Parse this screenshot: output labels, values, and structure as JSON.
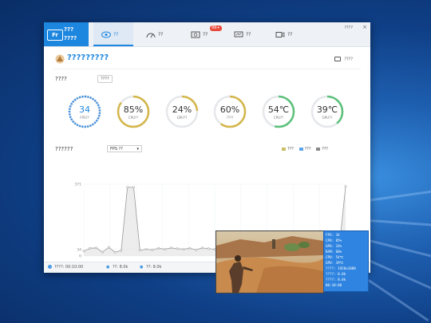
{
  "app": {
    "logo_mark": "Fr",
    "logo_line1": "???",
    "logo_line2": "????",
    "tabs": [
      {
        "label": "??",
        "icon": "eye-icon",
        "active": true
      },
      {
        "label": "??",
        "icon": "speedometer-icon",
        "active": false
      },
      {
        "label": "??",
        "icon": "screenshot-icon",
        "active": false,
        "badge": "99+"
      },
      {
        "label": "??",
        "icon": "network-icon",
        "active": false
      },
      {
        "label": "??",
        "icon": "video-icon",
        "active": false
      }
    ],
    "titlebar_right": "????"
  },
  "game": {
    "name": "?????????",
    "screenshot_label": "????"
  },
  "hardware": {
    "title": "????",
    "button": "????",
    "gauges": [
      {
        "value": "34",
        "label": "FPS??",
        "percent": 100,
        "color": "#3b8fe0",
        "dashed": true
      },
      {
        "value": "85%",
        "label": "CPU??",
        "percent": 85,
        "color": "#d4b64a"
      },
      {
        "value": "24%",
        "label": "GPU??",
        "percent": 24,
        "color": "#d4b64a"
      },
      {
        "value": "60%",
        "label": "????",
        "percent": 60,
        "color": "#d4b64a"
      },
      {
        "value": "54℃",
        "label": "CPU??",
        "percent": 54,
        "color": "#5cc07a"
      },
      {
        "value": "39℃",
        "label": "GPU??",
        "percent": 39,
        "color": "#5cc07a"
      }
    ]
  },
  "perf": {
    "title": "??????",
    "select": "FPS ??",
    "legend": [
      {
        "name": "???",
        "color": "#cbbf66"
      },
      {
        "name": "???",
        "color": "#5aa4e6"
      },
      {
        "name": "???",
        "color": "#888888"
      }
    ]
  },
  "chart_data": {
    "type": "line",
    "y_ticks": [
      "371",
      "34",
      "0"
    ],
    "ylim": [
      0,
      371
    ],
    "series": [
      {
        "values": [
          25,
          40,
          42,
          20,
          45,
          20,
          28,
          355,
          355,
          30,
          35,
          32,
          40,
          35,
          42,
          38,
          35,
          40,
          32,
          42,
          38,
          35,
          36,
          30,
          35,
          40,
          32,
          36,
          34,
          40,
          35,
          42,
          38,
          30,
          33,
          32,
          35,
          36,
          40,
          38,
          30,
          50,
          360
        ]
      }
    ]
  },
  "status": {
    "item1": "????: 00:10:00",
    "item2": "??: 8.0k",
    "item3": "??: 8.0k"
  },
  "hud": {
    "rows": [
      "FPS: 34",
      "CPU: 85%",
      "GPU: 24%",
      "RAM: 60%",
      "CPU: 54℃",
      "GPU: 39℃",
      "????: 1920x1080",
      "????: 8.0k",
      "????: 8.0k",
      "00:10:00"
    ]
  }
}
